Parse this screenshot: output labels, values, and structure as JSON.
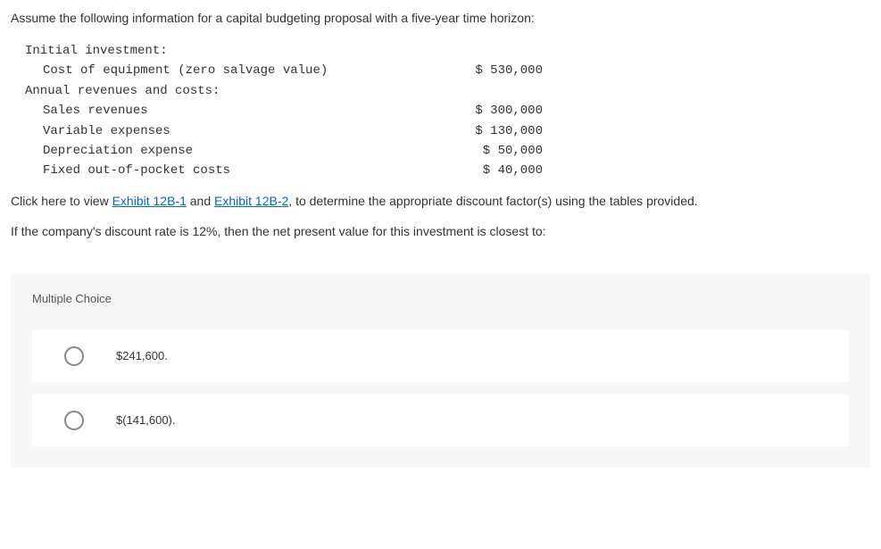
{
  "intro": "Assume the following information for a capital budgeting proposal with a five-year time horizon:",
  "tableRows": [
    {
      "label": "Initial investment:",
      "value": "",
      "indent": 0
    },
    {
      "label": "Cost of equipment (zero salvage value)",
      "value": "$ 530,000",
      "indent": 1
    },
    {
      "label": "Annual revenues and costs:",
      "value": "",
      "indent": 0
    },
    {
      "label": "Sales revenues",
      "value": "$ 300,000",
      "indent": 1
    },
    {
      "label": "Variable expenses",
      "value": "$ 130,000",
      "indent": 1
    },
    {
      "label": "Depreciation expense",
      "value": "$ 50,000",
      "indent": 1
    },
    {
      "label": "Fixed out-of-pocket costs",
      "value": "$ 40,000",
      "indent": 1
    }
  ],
  "clickHere": {
    "prefix": "Click here to view ",
    "link1": "Exhibit 12B-1",
    "mid": " and ",
    "link2": "Exhibit 12B-2",
    "suffix": ", to determine the appropriate discount factor(s) using the tables provided."
  },
  "questionText": "If the company's discount rate is 12%, then the net present value for this investment is closest to:",
  "mcHeading": "Multiple Choice",
  "options": [
    {
      "label": "$241,600."
    },
    {
      "label": "$(141,600)."
    }
  ]
}
